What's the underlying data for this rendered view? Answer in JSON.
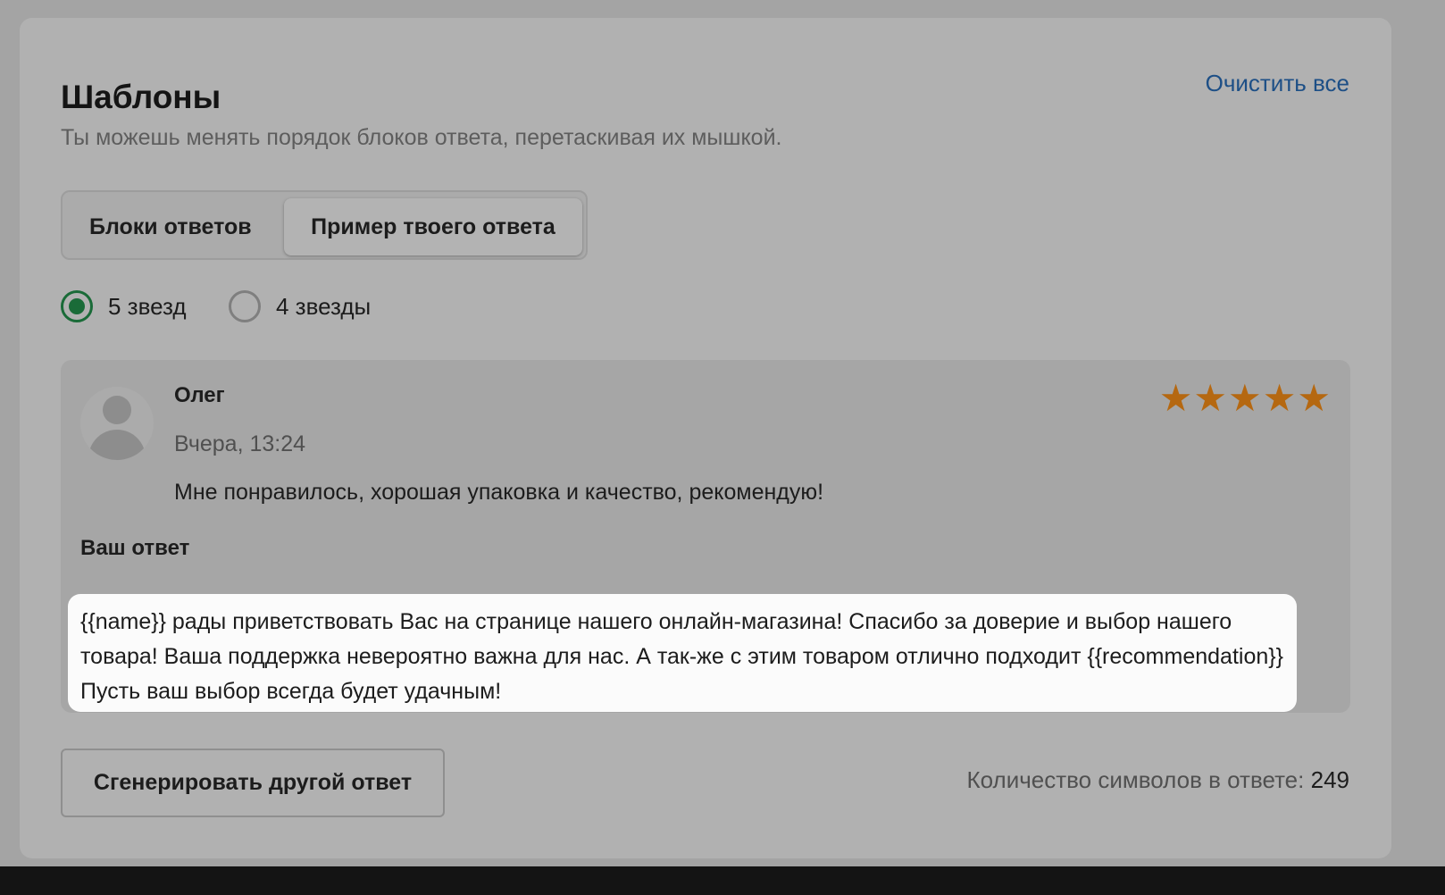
{
  "header": {
    "title": "Шаблоны",
    "clear_all_label": "Очистить все",
    "subtitle": "Ты можешь менять порядок блоков ответа, перетаскивая их мышкой."
  },
  "tabs": [
    {
      "label": "Блоки ответов",
      "active": false
    },
    {
      "label": "Пример твоего ответа",
      "active": true
    }
  ],
  "rating_filter": {
    "options": [
      {
        "label": "5 звезд",
        "selected": true
      },
      {
        "label": "4 звезды",
        "selected": false
      }
    ]
  },
  "review": {
    "author": "Олег",
    "date": "Вчера, 13:24",
    "text": "Мне понравилось, хорошая упаковка и качество, рекомендую!",
    "rating": 5,
    "reply_label": "Ваш ответ",
    "reply_text": "{{name}} рады приветствовать Вас на странице нашего онлайн-магазина! Спасибо за доверие и выбор нашего товара! Ваша поддержка невероятно важна для нас. А так-же с этим товаром отлично подходит {{recommendation}} Пусть ваш выбор всегда будет удачным!"
  },
  "footer": {
    "generate_label": "Сгенерировать другой ответ",
    "char_count_label": "Количество символов в ответе:",
    "char_count_value": "249"
  },
  "icons": {
    "star": "star-icon",
    "avatar": "user-avatar-icon"
  },
  "colors": {
    "accent_green": "#1a6b38",
    "link_blue": "#1d4f86",
    "star_orange": "#b56811"
  }
}
